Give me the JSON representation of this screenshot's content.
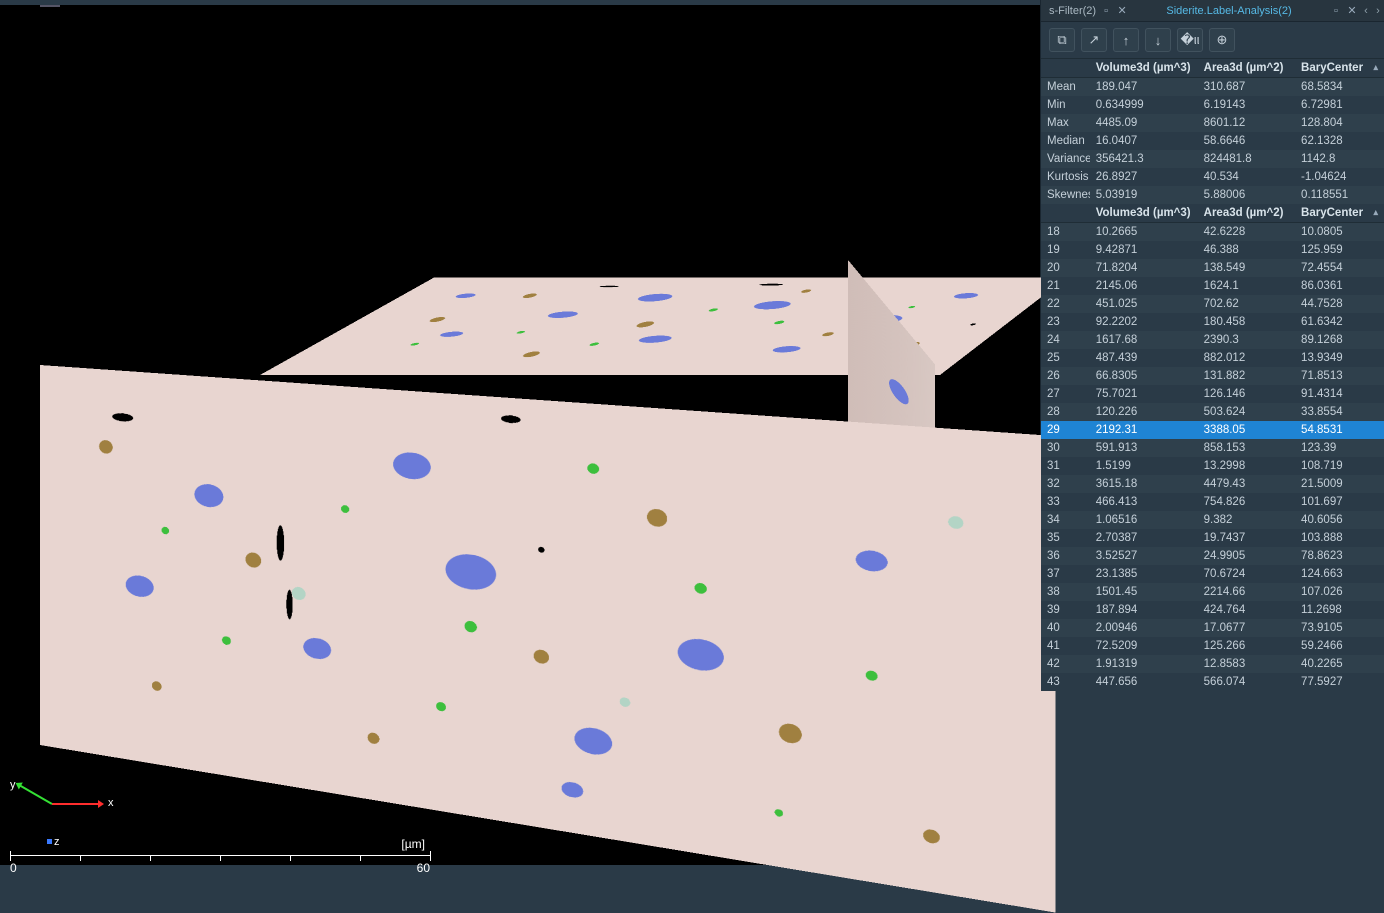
{
  "viewport": {
    "axis_labels": {
      "x": "x",
      "y": "y",
      "z": "z"
    },
    "scalebar": {
      "unit": "[µm]",
      "start": "0",
      "end": "60"
    }
  },
  "tabs": {
    "left_title": "s-Filter(2)",
    "active_title": "Siderite.Label-Analysis(2)"
  },
  "columns": {
    "idx": "",
    "vol": "Volume3d (µm^3)",
    "area": "Area3d (µm^2)",
    "bary": "BaryCenter"
  },
  "stats": [
    {
      "label": "Mean",
      "vol": "189.047",
      "area": "310.687",
      "bary": "68.5834"
    },
    {
      "label": "Min",
      "vol": "0.634999",
      "area": "6.19143",
      "bary": "6.72981"
    },
    {
      "label": "Max",
      "vol": "4485.09",
      "area": "8601.12",
      "bary": "128.804"
    },
    {
      "label": "Median",
      "vol": "16.0407",
      "area": "58.6646",
      "bary": "62.1328"
    },
    {
      "label": "Variance",
      "vol": "356421.3",
      "area": "824481.8",
      "bary": "1142.8"
    },
    {
      "label": "Kurtosis",
      "vol": "26.8927",
      "area": "40.534",
      "bary": "-1.04624"
    },
    {
      "label": "Skewness",
      "vol": "5.03919",
      "area": "5.88006",
      "bary": "0.118551"
    }
  ],
  "selected_id": "29",
  "rows": [
    {
      "id": "18",
      "vol": "10.2665",
      "area": "42.6228",
      "bary": "10.0805"
    },
    {
      "id": "19",
      "vol": "9.42871",
      "area": "46.388",
      "bary": "125.959"
    },
    {
      "id": "20",
      "vol": "71.8204",
      "area": "138.549",
      "bary": "72.4554"
    },
    {
      "id": "21",
      "vol": "2145.06",
      "area": "1624.1",
      "bary": "86.0361"
    },
    {
      "id": "22",
      "vol": "451.025",
      "area": "702.62",
      "bary": "44.7528"
    },
    {
      "id": "23",
      "vol": "92.2202",
      "area": "180.458",
      "bary": "61.6342"
    },
    {
      "id": "24",
      "vol": "1617.68",
      "area": "2390.3",
      "bary": "89.1268"
    },
    {
      "id": "25",
      "vol": "487.439",
      "area": "882.012",
      "bary": "13.9349"
    },
    {
      "id": "26",
      "vol": "66.8305",
      "area": "131.882",
      "bary": "71.8513"
    },
    {
      "id": "27",
      "vol": "75.7021",
      "area": "126.146",
      "bary": "91.4314"
    },
    {
      "id": "28",
      "vol": "120.226",
      "area": "503.624",
      "bary": "33.8554"
    },
    {
      "id": "29",
      "vol": "2192.31",
      "area": "3388.05",
      "bary": "54.8531"
    },
    {
      "id": "30",
      "vol": "591.913",
      "area": "858.153",
      "bary": "123.39"
    },
    {
      "id": "31",
      "vol": "1.5199",
      "area": "13.2998",
      "bary": "108.719"
    },
    {
      "id": "32",
      "vol": "3615.18",
      "area": "4479.43",
      "bary": "21.5009"
    },
    {
      "id": "33",
      "vol": "466.413",
      "area": "754.826",
      "bary": "101.697"
    },
    {
      "id": "34",
      "vol": "1.06516",
      "area": "9.382",
      "bary": "40.6056"
    },
    {
      "id": "35",
      "vol": "2.70387",
      "area": "19.7437",
      "bary": "103.888"
    },
    {
      "id": "36",
      "vol": "3.52527",
      "area": "24.9905",
      "bary": "78.8623"
    },
    {
      "id": "37",
      "vol": "23.1385",
      "area": "70.6724",
      "bary": "124.663"
    },
    {
      "id": "38",
      "vol": "1501.45",
      "area": "2214.66",
      "bary": "107.026"
    },
    {
      "id": "39",
      "vol": "187.894",
      "area": "424.764",
      "bary": "11.2698"
    },
    {
      "id": "40",
      "vol": "2.00946",
      "area": "17.0677",
      "bary": "73.9105"
    },
    {
      "id": "41",
      "vol": "72.5209",
      "area": "125.266",
      "bary": "59.2466"
    },
    {
      "id": "42",
      "vol": "1.91319",
      "area": "12.8583",
      "bary": "40.2265"
    },
    {
      "id": "43",
      "vol": "447.656",
      "area": "566.074",
      "bary": "77.5927"
    }
  ]
}
